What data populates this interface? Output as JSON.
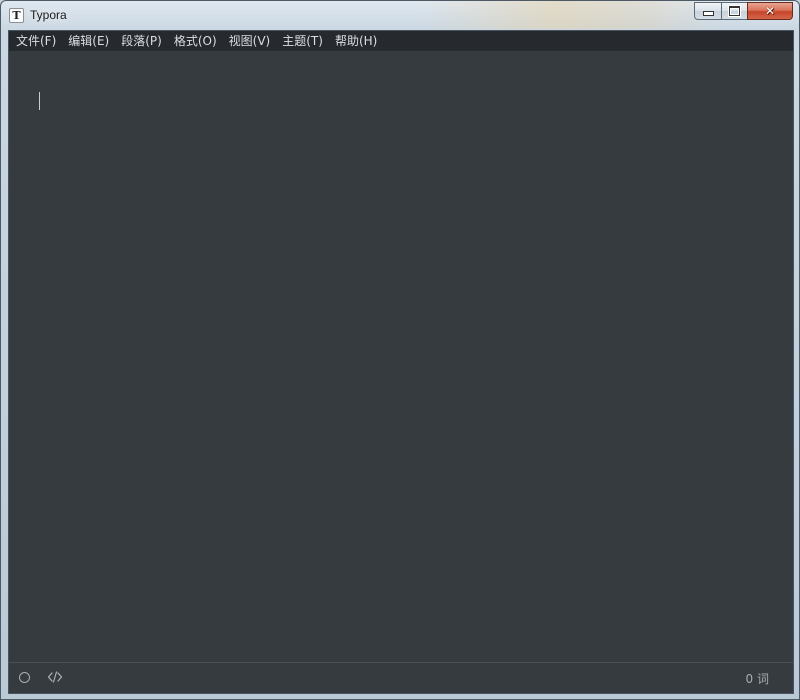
{
  "window": {
    "title": "Typora",
    "app_icon_letter": "T",
    "controls": {
      "minimize_icon": "minimize-icon",
      "maximize_icon": "maximize-icon",
      "close_icon": "close-icon",
      "close_glyph": "✕"
    }
  },
  "menubar": {
    "items": [
      {
        "label": "文件(F)"
      },
      {
        "label": "编辑(E)"
      },
      {
        "label": "段落(P)"
      },
      {
        "label": "格式(O)"
      },
      {
        "label": "视图(V)"
      },
      {
        "label": "主题(T)"
      },
      {
        "label": "帮助(H)"
      }
    ]
  },
  "editor": {
    "content": ""
  },
  "statusbar": {
    "sidebar_toggle_icon": "circle-outline-icon",
    "source_mode_icon": "code-icon",
    "word_count": "0 词"
  },
  "colors": {
    "editor_background": "#363b40",
    "menubar_background": "#262a2e",
    "menu_text": "#dcdfe2",
    "status_text": "#a7adb3",
    "close_button": "#c7452b"
  }
}
